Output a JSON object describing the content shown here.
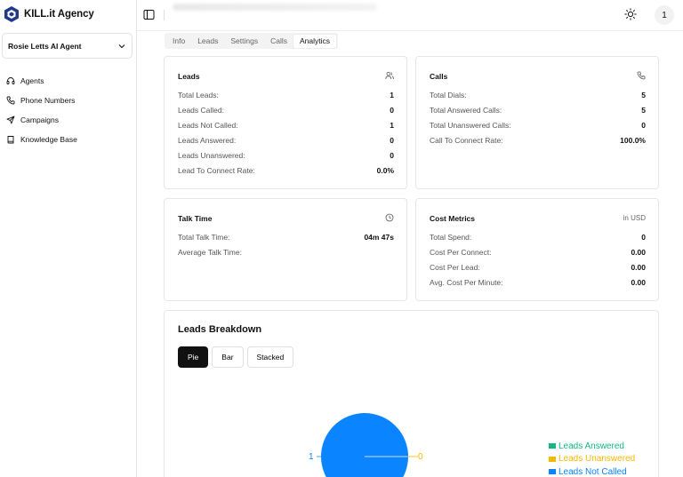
{
  "brand": {
    "name": "KILL.it Agency"
  },
  "agent_select": {
    "label": "Rosie Letts AI Agent"
  },
  "sidebar": {
    "items": [
      {
        "label": "Agents",
        "icon": "headset-icon"
      },
      {
        "label": "Phone Numbers",
        "icon": "phone-icon"
      },
      {
        "label": "Campaigns",
        "icon": "send-icon"
      },
      {
        "label": "Knowledge Base",
        "icon": "book-icon"
      }
    ]
  },
  "topbar": {
    "avatar": "1"
  },
  "tabs": [
    {
      "label": "Info"
    },
    {
      "label": "Leads"
    },
    {
      "label": "Settings"
    },
    {
      "label": "Calls"
    },
    {
      "label": "Analytics",
      "active": true
    }
  ],
  "cards": {
    "leads": {
      "title": "Leads",
      "rows": [
        {
          "label": "Total Leads:",
          "value": "1"
        },
        {
          "label": "Leads Called:",
          "value": "0"
        },
        {
          "label": "Leads Not Called:",
          "value": "1"
        },
        {
          "label": "Leads Answered:",
          "value": "0"
        },
        {
          "label": "Leads Unanswered:",
          "value": "0"
        },
        {
          "label": "Lead To Connect Rate:",
          "value": "0.0%"
        }
      ]
    },
    "calls": {
      "title": "Calls",
      "rows": [
        {
          "label": "Total Dials:",
          "value": "5"
        },
        {
          "label": "Total Answered Calls:",
          "value": "5"
        },
        {
          "label": "Total Unanswered Calls:",
          "value": "0"
        },
        {
          "label": "Call To Connect Rate:",
          "value": "100.0%"
        }
      ]
    },
    "talk": {
      "title": "Talk Time",
      "rows": [
        {
          "label": "Total Talk Time:",
          "value": "04m 47s"
        },
        {
          "label": "Average Talk Time:",
          "value": ""
        }
      ]
    },
    "cost": {
      "title": "Cost Metrics",
      "unit": "in USD",
      "rows": [
        {
          "label": "Total Spend:",
          "value": "0"
        },
        {
          "label": "Cost Per Connect:",
          "value": "0.00"
        },
        {
          "label": "Cost Per Lead:",
          "value": "0.00"
        },
        {
          "label": "Avg. Cost Per Minute:",
          "value": "0.00"
        }
      ]
    }
  },
  "breakdown": {
    "title": "Leads Breakdown",
    "buttons": [
      {
        "label": "Pie",
        "active": true
      },
      {
        "label": "Bar"
      },
      {
        "label": "Stacked"
      }
    ]
  },
  "chart_data": {
    "type": "pie",
    "slices": [
      {
        "name": "Leads Answered",
        "value": 0,
        "color": "#10b981"
      },
      {
        "name": "Leads Unanswered",
        "value": 0,
        "color": "#f5b800"
      },
      {
        "name": "Leads Not Called",
        "value": 1,
        "color": "#0a84ff"
      }
    ],
    "data_labels": {
      "left": "1",
      "right": "0"
    },
    "legend_position": "bottom-right"
  },
  "colors": {
    "accent": "#0a84ff",
    "dark": "#111111"
  }
}
